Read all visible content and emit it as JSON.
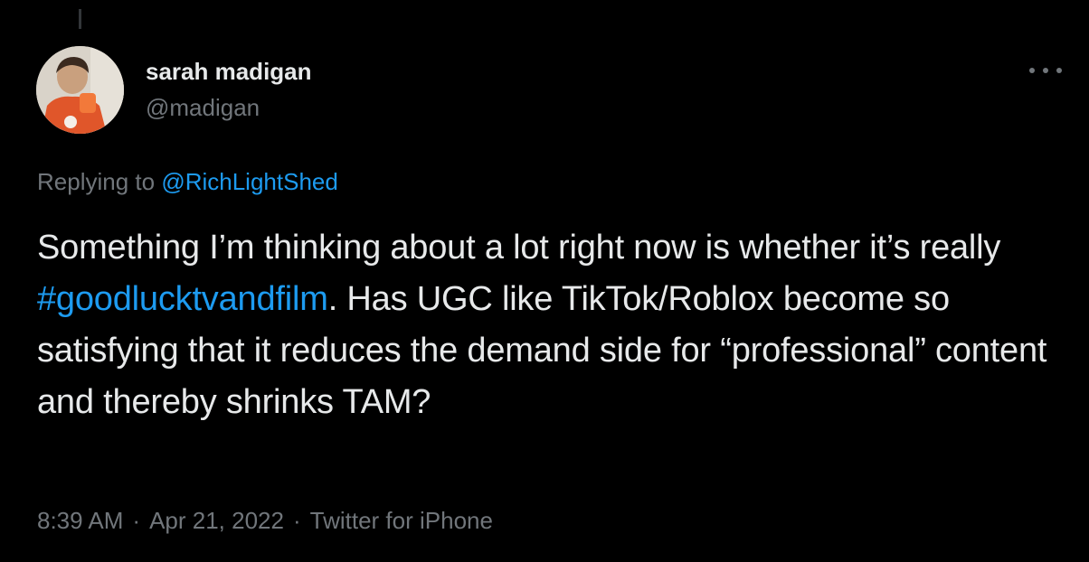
{
  "author": {
    "display_name": "sarah madigan",
    "handle": "@madigan"
  },
  "icons": {
    "more": "more-horizontal-icon",
    "avatar": "profile-photo"
  },
  "reply_context": {
    "prefix": "Replying to ",
    "mention": "@RichLightShed"
  },
  "tweet": {
    "text_part_1": "Something I’m thinking about a lot right now is whether it’s really ",
    "hashtag": "#goodlucktvandfilm",
    "text_part_2": ". Has UGC like TikTok/Roblox become so satisfying that it reduces the demand side for “professional” content and thereby shrinks TAM?"
  },
  "meta": {
    "time": "8:39 AM",
    "separator": "·",
    "date": "Apr 21, 2022",
    "source": "Twitter for iPhone"
  },
  "colors": {
    "background": "#000000",
    "text": "#e7e9ea",
    "secondary": "#71767b",
    "link": "#1d9bf0"
  }
}
